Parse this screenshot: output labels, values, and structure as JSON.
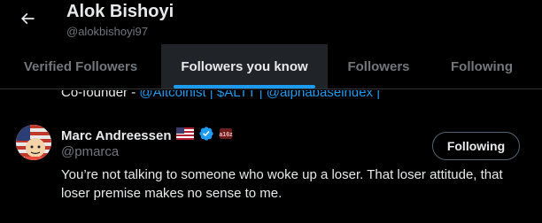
{
  "header": {
    "back_label": "Back",
    "name": "Alok Bishoyi",
    "handle": "@alokbishoyi97"
  },
  "tabs": [
    {
      "label": "Verified Followers",
      "active": false
    },
    {
      "label": "Followers you know",
      "active": true
    },
    {
      "label": "Followers",
      "active": false
    },
    {
      "label": "Following",
      "active": false
    }
  ],
  "previous_bio": {
    "prefix": "Co-founder - ",
    "links": [
      "@Altcoinist",
      "$ALTT",
      "@alphabaseindex"
    ],
    "separator": " | ",
    "trailing": " |"
  },
  "user": {
    "display_name": "Marc Andreessen",
    "handle": "@pmarca",
    "badges": [
      "us-flag-icon",
      "verified-badge-icon",
      "affiliate-badge-icon"
    ],
    "follow_button": "Following",
    "bio": "You’re not talking to someone who woke up a loser. That loser attitude, that loser premise makes no sense to me."
  },
  "colors": {
    "background": "#000000",
    "text_primary": "#e7e9ea",
    "text_secondary": "#71767b",
    "accent": "#1d9bf0",
    "active_tab_bg": "#202327",
    "border": "#2f3336"
  }
}
